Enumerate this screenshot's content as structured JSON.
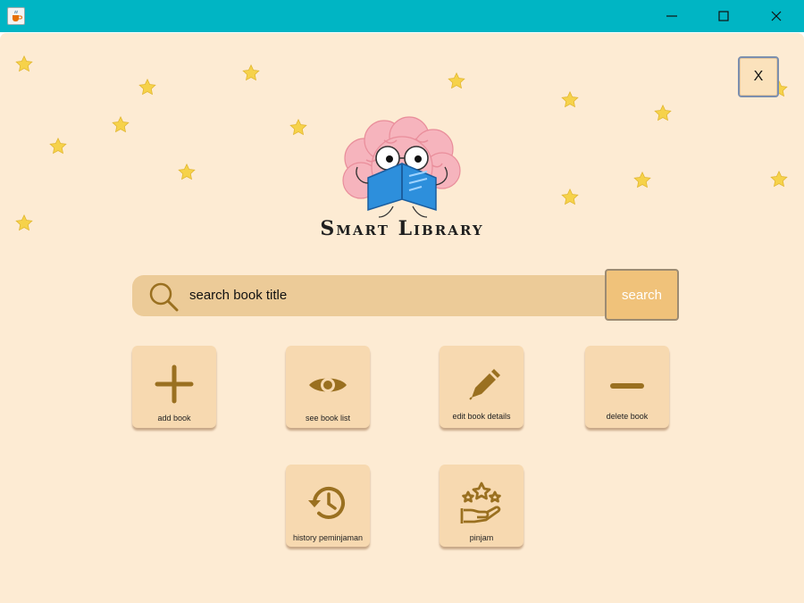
{
  "window": {
    "app_icon": "java-cup-icon",
    "controls": [
      "minimize-icon",
      "maximize-icon",
      "close-icon"
    ]
  },
  "close_button": {
    "label": "X"
  },
  "brand": {
    "title": "Smart Library",
    "logo": "brain-reading-book-logo"
  },
  "search": {
    "placeholder": "search book title",
    "button_label": "search",
    "icon": "magnifier-icon"
  },
  "menu": [
    {
      "label": "add book",
      "icon": "plus-icon"
    },
    {
      "label": "see book list",
      "icon": "eye-icon"
    },
    {
      "label": "edit book details",
      "icon": "pencil-icon"
    },
    {
      "label": "delete book",
      "icon": "minus-icon"
    },
    {
      "label": "history peminjaman",
      "icon": "history-icon"
    },
    {
      "label": "pinjam",
      "icon": "hand-stars-icon"
    }
  ],
  "colors": {
    "titlebar": "#00b5c4",
    "background": "#fdebd3",
    "tile": "#f7d9b0",
    "icon": "#9a7020",
    "search_bar": "#eccb98",
    "search_button": "#f0c27a",
    "star": "#f6d24a"
  }
}
